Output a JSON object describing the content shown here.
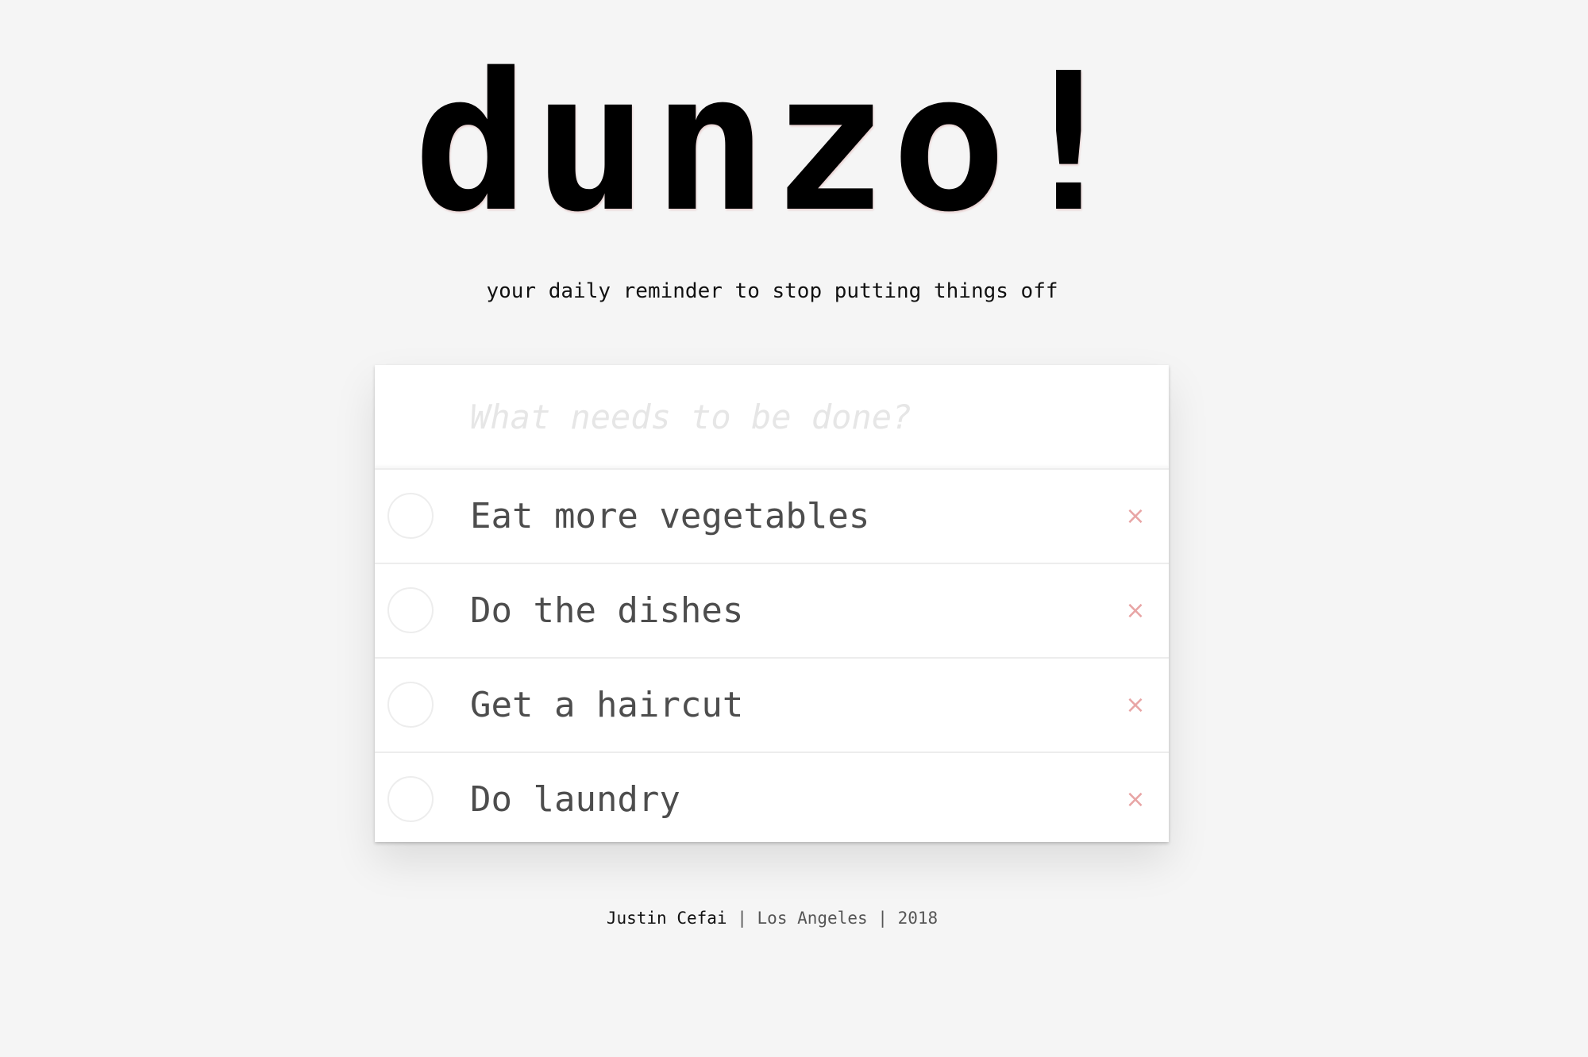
{
  "header": {
    "title": "dunzo!",
    "tagline": "your daily reminder to stop putting things off"
  },
  "new_todo": {
    "placeholder": "What needs to be done?",
    "value": ""
  },
  "todos": [
    {
      "label": "Eat more vegetables",
      "completed": false,
      "remove_icon": "×"
    },
    {
      "label": "Do the dishes",
      "completed": false,
      "remove_icon": "×"
    },
    {
      "label": "Get a haircut",
      "completed": false,
      "remove_icon": "×"
    },
    {
      "label": "Do laundry",
      "completed": false,
      "remove_icon": "×"
    }
  ],
  "footer": {
    "author": "Justin Cefai",
    "separator": "|",
    "location": "Los Angeles",
    "year": "2018"
  },
  "colors": {
    "background": "#f5f5f5",
    "card": "#ffffff",
    "text": "#4d4d4d",
    "placeholder": "#e6e6e6",
    "destroy": "#e8a5a5"
  }
}
